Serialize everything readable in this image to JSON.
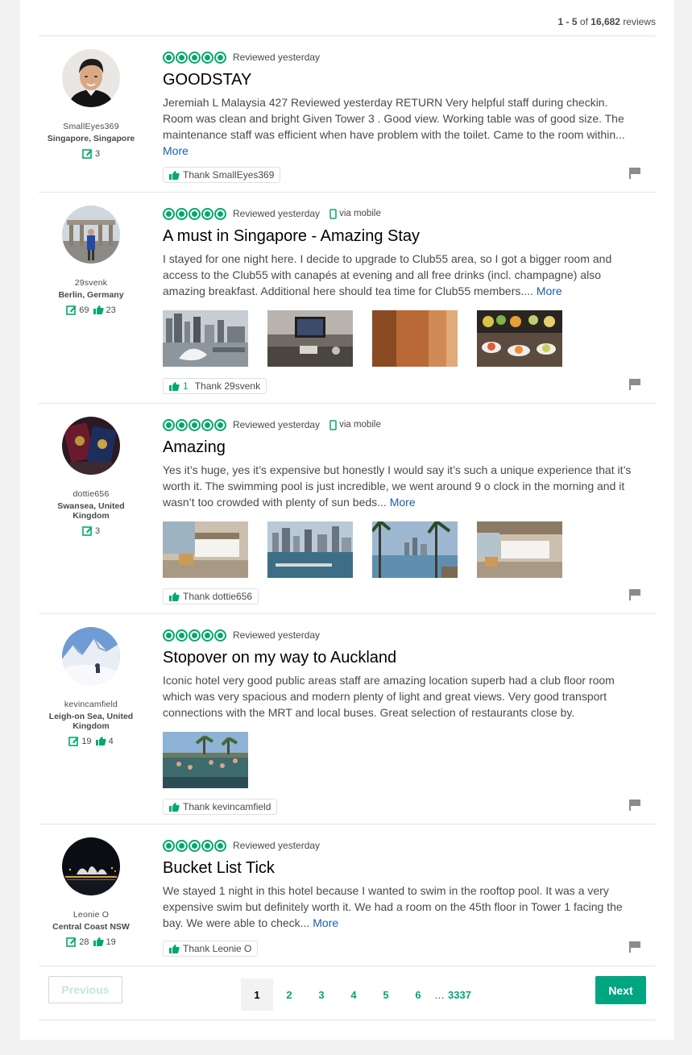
{
  "header": {
    "range": "1 - 5",
    "of_word": "of",
    "total": "16,682",
    "reviews_word": "reviews"
  },
  "reviews": [
    {
      "username": "SmallEyes369",
      "location": "Singapore, Singapore",
      "review_count": "3",
      "helpful_count": "",
      "rating": 5,
      "date": "Reviewed yesterday",
      "via_mobile": "",
      "title": "GOODSTAY",
      "text": "Jeremiah L Malaysia 427 Reviewed yesterday RETURN Very helpful staff during checkin. Room was clean and bright Given Tower 3 . Good view. Working table was of good size. The maintenance staff was efficient when have problem with the toilet. Came to the room within...",
      "more": "More",
      "thank_count": "",
      "thank_label": "Thank SmallEyes369"
    },
    {
      "username": "29svenk",
      "location": "Berlin, Germany",
      "review_count": "69",
      "helpful_count": "23",
      "rating": 5,
      "date": "Reviewed yesterday",
      "via_mobile": "via mobile",
      "title": "A must in Singapore - Amazing Stay",
      "text": "I stayed for one night here. I decide to upgrade to Club55 area, so I got a bigger room and access to the Club55 with canapés at evening and all free drinks (incl. champagne) also amazing breakfast. Additional here should tea time for Club55 members....",
      "more": "More",
      "thank_count": "1",
      "thank_label": "Thank 29svenk"
    },
    {
      "username": "dottie656",
      "location": "Swansea, United Kingdom",
      "review_count": "3",
      "helpful_count": "",
      "rating": 5,
      "date": "Reviewed yesterday",
      "via_mobile": "via mobile",
      "title": "Amazing",
      "text": "Yes it’s huge, yes it’s expensive but honestly I would say it’s such a unique experience that it’s worth it. The swimming pool is just incredible, we went around 9 o clock in the morning and it wasn’t too crowded with plenty of sun beds...",
      "more": "More",
      "thank_count": "",
      "thank_label": "Thank dottie656"
    },
    {
      "username": "kevincamfield",
      "location": "Leigh-on Sea, United Kingdom",
      "review_count": "19",
      "helpful_count": "4",
      "rating": 5,
      "date": "Reviewed yesterday",
      "via_mobile": "",
      "title": "Stopover on my way to Auckland",
      "text": "Iconic hotel very good public areas staff are amazing location superb had a club floor room which was very spacious and modern plenty of light and great views. Very good transport connections with the MRT and local buses. Great selection of restaurants close by.",
      "more": "",
      "thank_count": "",
      "thank_label": "Thank kevincamfield"
    },
    {
      "username": "Leonie O",
      "location": "Central Coast NSW",
      "review_count": "28",
      "helpful_count": "19",
      "rating": 5,
      "date": "Reviewed yesterday",
      "via_mobile": "",
      "title": "Bucket List Tick",
      "text": "We stayed 1 night in this hotel because I wanted to swim in the rooftop pool. It was a very expensive swim but definitely worth it. We had a room on the 45th floor in Tower 1 facing the bay. We were able to check...",
      "more": "More",
      "thank_count": "",
      "thank_label": "Thank Leonie O"
    }
  ],
  "pagination": {
    "previous": "Previous",
    "next": "Next",
    "pages": [
      "1",
      "2",
      "3",
      "4",
      "5",
      "6"
    ],
    "current": "1",
    "ellipsis": "…",
    "last": "3337"
  },
  "colors": {
    "accent": "#00aa6c",
    "link": "#1a5ea8",
    "next_button": "#00a680"
  }
}
